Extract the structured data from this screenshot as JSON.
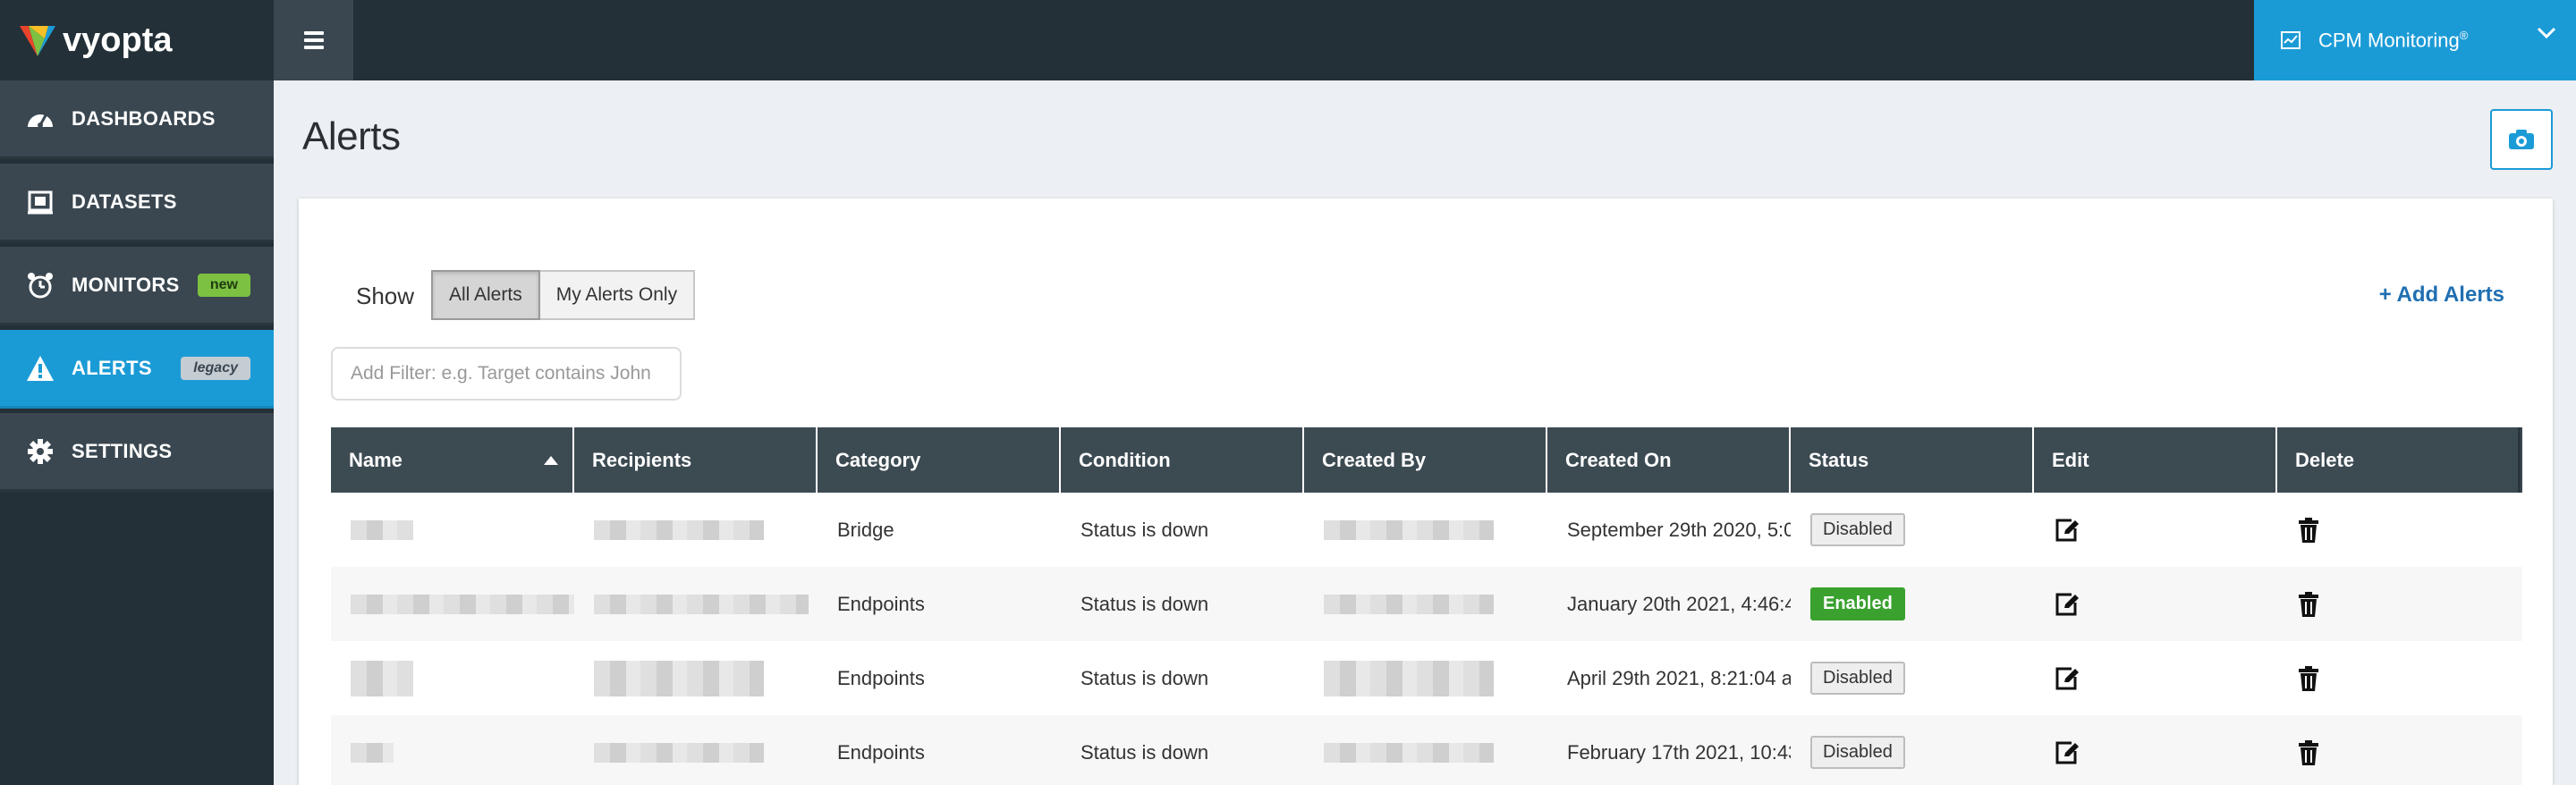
{
  "brand": {
    "name": "vyopta",
    "logo_colors": [
      "#e8432b",
      "#7cc142",
      "#1b9bd6"
    ]
  },
  "topbar": {
    "menu_icon": "hamburger-icon",
    "product_label": "CPM Monitoring",
    "product_mark": "®",
    "product_icon": "dashboard-card-icon",
    "dropdown_icon": "chevron-down-icon"
  },
  "sidebar": {
    "items": [
      {
        "label": "DASHBOARDS",
        "icon": "speedometer-icon",
        "badge": ""
      },
      {
        "label": "DATASETS",
        "icon": "dataset-icon",
        "badge": ""
      },
      {
        "label": "MONITORS",
        "icon": "alarm-clock-icon",
        "badge": "new"
      },
      {
        "label": "ALERTS",
        "icon": "warning-icon",
        "badge": "legacy",
        "active": true
      },
      {
        "label": "SETTINGS",
        "icon": "gear-icon",
        "badge": ""
      }
    ]
  },
  "page": {
    "title": "Alerts",
    "camera_icon": "camera-icon"
  },
  "controls": {
    "show_label": "Show",
    "all_alerts": "All Alerts",
    "my_alerts": "My Alerts Only",
    "add_alerts": "+ Add Alerts",
    "filter_placeholder": "Add Filter: e.g. Target contains John"
  },
  "table": {
    "columns": [
      "Name",
      "Recipients",
      "Category",
      "Condition",
      "Created By",
      "Created On",
      "Status",
      "Edit",
      "Delete"
    ],
    "sorted_column": "Name",
    "rows": [
      {
        "category": "Bridge",
        "condition": "Status is down",
        "created_on": "September 29th 2020, 5:0",
        "status": "Disabled"
      },
      {
        "category": "Endpoints",
        "condition": "Status is down",
        "created_on": "January 20th 2021, 4:46:4",
        "status": "Enabled"
      },
      {
        "category": "Endpoints",
        "condition": "Status is down",
        "created_on": "April 29th 2021, 8:21:04 an",
        "status": "Disabled"
      },
      {
        "category": "Endpoints",
        "condition": "Status is down",
        "created_on": "February 17th 2021, 10:43:",
        "status": "Disabled"
      }
    ]
  },
  "colors": {
    "sidebar_bg": "#243038",
    "nav_item_bg": "#3a4750",
    "accent": "#1b9bd6",
    "enabled": "#3aa12f",
    "table_header": "#3c4a52"
  }
}
